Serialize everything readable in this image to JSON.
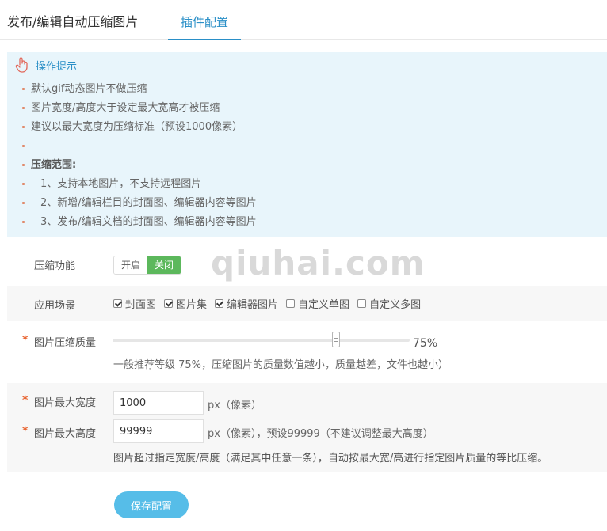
{
  "tabs": [
    {
      "label": "发布/编辑自动压缩图片",
      "active": false
    },
    {
      "label": "插件配置",
      "active": true
    }
  ],
  "tips": {
    "title": "操作提示",
    "items": [
      "默认gif动态图片不做压缩",
      "图片宽度/高度大于设定最大宽高才被压缩",
      "建议以最大宽度为压缩标准（预设1000像素）",
      "",
      "压缩范围:",
      "1、支持本地图片，不支持远程图片",
      "2、新增/编辑栏目的封面图、编辑器内容等图片",
      "3、发布/编辑文档的封面图、编辑器内容等图片"
    ]
  },
  "compress": {
    "label": "压缩功能",
    "on_label": "开启",
    "off_label": "关闭",
    "state": "off"
  },
  "scene": {
    "label": "应用场景",
    "options": [
      {
        "label": "封面图",
        "checked": true
      },
      {
        "label": "图片集",
        "checked": true
      },
      {
        "label": "编辑器图片",
        "checked": true
      },
      {
        "label": "自定义单图",
        "checked": false
      },
      {
        "label": "自定义多图",
        "checked": false
      }
    ]
  },
  "quality": {
    "required_mark": "*",
    "label": "图片压缩质量",
    "value": 75,
    "value_text": "75%",
    "hint": "一般推荐等级 75%，压缩图片的质量数值越小，质量越差，文件也越小）"
  },
  "max_width": {
    "required_mark": "*",
    "label": "图片最大宽度",
    "value": "1000",
    "unit": "px（像素）"
  },
  "max_height": {
    "required_mark": "*",
    "label": "图片最大高度",
    "value": "99999",
    "unit": "px（像素），预设99999（不建议调整最大高度）"
  },
  "size_hint": "图片超过指定宽度/高度（满足其中任意一条），自动按最大宽/高进行指定图片质量的等比压缩。",
  "save_label": "保存配置",
  "watermark": "qiuhai.com",
  "colors": {
    "accent": "#2a8fc7",
    "tip_bg": "#e8f5fb",
    "toggle_off": "#5cb85c",
    "save_button": "#56bde8",
    "required": "#e8612c"
  }
}
